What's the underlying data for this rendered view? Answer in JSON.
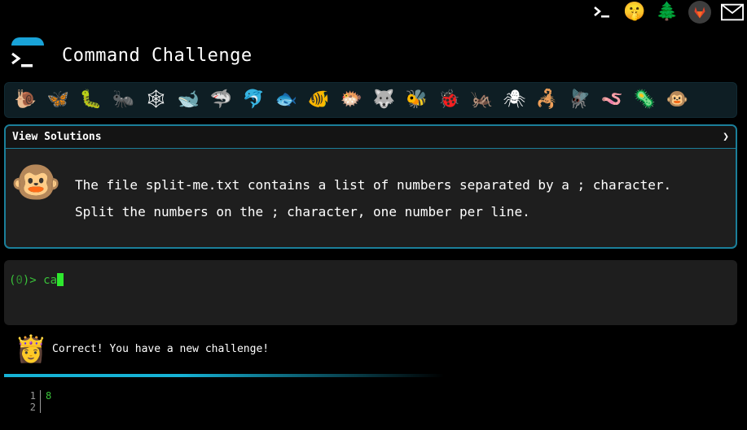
{
  "top_icons": [
    {
      "name": "terminal-icon",
      "glyph": "▶"
    },
    {
      "name": "shushing-face-icon",
      "glyph": "🤫"
    },
    {
      "name": "tree-icon",
      "glyph": "🌲"
    },
    {
      "name": "gitlab-icon",
      "glyph": "🦊"
    },
    {
      "name": "mail-icon",
      "glyph": "✉"
    }
  ],
  "header": {
    "title": "Command Challenge"
  },
  "animals": [
    {
      "name": "snail-icon",
      "glyph": "🐌"
    },
    {
      "name": "butterfly-icon",
      "glyph": "🦋"
    },
    {
      "name": "caterpillar-icon",
      "glyph": "🐛"
    },
    {
      "name": "ant-icon",
      "glyph": "🐜"
    },
    {
      "name": "spider-web-icon",
      "glyph": "🕸"
    },
    {
      "name": "whale-icon",
      "glyph": "🐋"
    },
    {
      "name": "shark-icon",
      "glyph": "🦈"
    },
    {
      "name": "dolphin-icon",
      "glyph": "🐬"
    },
    {
      "name": "fish-icon",
      "glyph": "🐟"
    },
    {
      "name": "tropical-fish-icon",
      "glyph": "🐠"
    },
    {
      "name": "blowfish-icon",
      "glyph": "🐡"
    },
    {
      "name": "wolf-icon",
      "glyph": "🐺"
    },
    {
      "name": "bee-icon",
      "glyph": "🐝"
    },
    {
      "name": "ladybug-icon",
      "glyph": "🐞"
    },
    {
      "name": "cricket-icon",
      "glyph": "🦗"
    },
    {
      "name": "spider-icon",
      "glyph": "🕷"
    },
    {
      "name": "scorpion-icon",
      "glyph": "🦂"
    },
    {
      "name": "fly-icon",
      "glyph": "🪰"
    },
    {
      "name": "worm-icon",
      "glyph": "🪱"
    },
    {
      "name": "microbe-icon",
      "glyph": "🦠"
    },
    {
      "name": "monkey-face-icon",
      "glyph": "🐵"
    }
  ],
  "challenge": {
    "solutions_label": "View Solutions",
    "chevron": "❯",
    "avatar": "🐵",
    "line1": "The file split-me.txt contains a list of numbers separated by a ; character.",
    "line2": "Split the numbers on the ; character, one number per line."
  },
  "terminal": {
    "prompt_open": "(",
    "prompt_num": "0",
    "prompt_close": ")> ",
    "command": "ca"
  },
  "feedback": {
    "avatar": "👸",
    "message": "Correct! You have a new challenge!"
  },
  "output": {
    "line_numbers": [
      "1",
      "2"
    ],
    "lines": [
      "8",
      ""
    ]
  },
  "colors": {
    "accent": "#1b7f9a",
    "prompt": "#3ac33a",
    "cursor": "#2ee82e",
    "progress": "#16b3d6"
  }
}
